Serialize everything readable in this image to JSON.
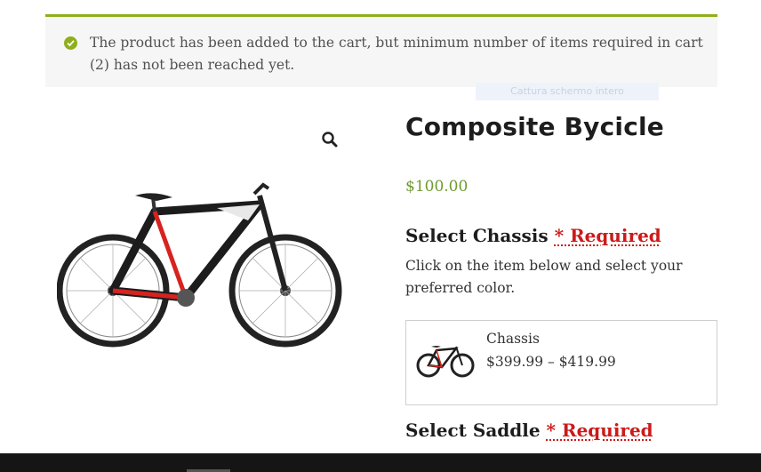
{
  "notice": {
    "message": "The product has been added to the cart, but minimum number of items required in cart (2) has not been reached yet.",
    "color": "#8fae1b",
    "icon": "check-circle-icon"
  },
  "overlay_hint": "Cattura schermo intero",
  "product": {
    "title": "Composite Bycicle",
    "price": "$100.00"
  },
  "sections": [
    {
      "title": "Select Chassis",
      "required": "* Required",
      "description": "Click on the item below and select your preferred color.",
      "options": [
        {
          "name": "Chassis",
          "price_range": "$399.99 – $419.99"
        }
      ]
    },
    {
      "title": "Select Saddle",
      "required": "* Required"
    }
  ],
  "colors": {
    "price": "#6e9a2f",
    "required": "#cc1a1a"
  }
}
